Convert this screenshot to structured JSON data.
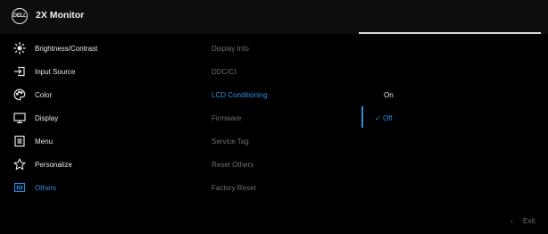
{
  "header": {
    "logo_text": "DELL",
    "title": "2X Monitor"
  },
  "menu": [
    {
      "label": "Brightness/Contrast",
      "icon": "brightness-icon"
    },
    {
      "label": "Input Source",
      "icon": "input-source-icon"
    },
    {
      "label": "Color",
      "icon": "color-palette-icon"
    },
    {
      "label": "Display",
      "icon": "display-icon"
    },
    {
      "label": "Menu",
      "icon": "menu-icon"
    },
    {
      "label": "Personalize",
      "icon": "star-icon"
    },
    {
      "label": "Others",
      "icon": "others-icon",
      "active": true
    }
  ],
  "submenu": [
    {
      "label": "Display Info"
    },
    {
      "label": "DDC/CI"
    },
    {
      "label": "LCD Conditioning",
      "active": true
    },
    {
      "label": "Firmware"
    },
    {
      "label": "Service Tag"
    },
    {
      "label": "Reset Others"
    },
    {
      "label": "Factory Reset"
    }
  ],
  "options": [
    {
      "label": "On"
    },
    {
      "label": "Off",
      "selected": true
    }
  ],
  "footer": {
    "exit_label": "Exit"
  },
  "colors": {
    "accent": "#2d8ee0",
    "background": "#000000",
    "header": "#0d0d0d",
    "text": "#e6e6e6",
    "muted": "#6f6f6f"
  }
}
